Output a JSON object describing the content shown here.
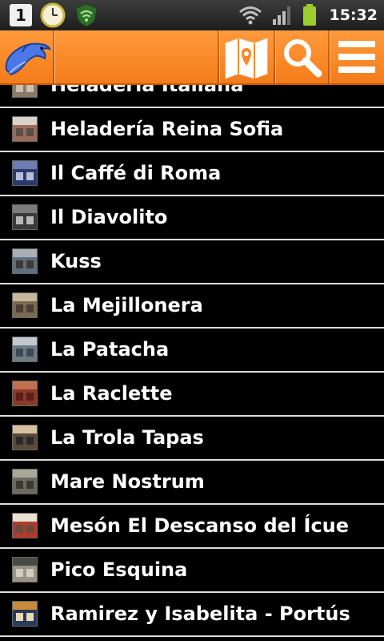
{
  "status_bar": {
    "time": "15:32",
    "notification_badge": "1"
  },
  "app_bar": {
    "logo_icon": "dolphin-logo-icon",
    "map_icon": "map-icon",
    "search_icon": "search-icon",
    "menu_icon": "menu-icon",
    "accent_color": "#f47c1a"
  },
  "list": {
    "items": [
      {
        "label": "Heladería Italiana",
        "thumb": [
          "#8a7a6a",
          "#4d5966",
          "#c9c0b2"
        ]
      },
      {
        "label": "Heladería Reina Sofia",
        "thumb": [
          "#9b6b5a",
          "#d8d2c8",
          "#5a4e46"
        ]
      },
      {
        "label": "Il Caffé di Roma",
        "thumb": [
          "#2c3a6b",
          "#6c7db3",
          "#b5bedb"
        ]
      },
      {
        "label": "Il Diavolito",
        "thumb": [
          "#3a3a3a",
          "#7c7c7c",
          "#b8b8b8"
        ]
      },
      {
        "label": "Kuss",
        "thumb": [
          "#5e6f80",
          "#a8b0b6",
          "#3f3a36"
        ]
      },
      {
        "label": "La Mejillonera",
        "thumb": [
          "#7a6a52",
          "#c8b89a",
          "#4a3e32"
        ]
      },
      {
        "label": "La Patacha",
        "thumb": [
          "#6f7a82",
          "#c3c8cc",
          "#3d4a52"
        ]
      },
      {
        "label": "La Raclette",
        "thumb": [
          "#8b3a2a",
          "#c07050",
          "#5a2018"
        ]
      },
      {
        "label": "La Trola Tapas",
        "thumb": [
          "#5a4a3a",
          "#d8c0a0",
          "#2a2a2a"
        ]
      },
      {
        "label": "Mare Nostrum",
        "thumb": [
          "#6a6a5e",
          "#a8a898",
          "#3a3a30"
        ]
      },
      {
        "label": "Mesón El Descanso del Ícue",
        "thumb": [
          "#b23a2a",
          "#e8e0d0",
          "#6a4a3a"
        ]
      },
      {
        "label": "Pico Esquina",
        "thumb": [
          "#9a9486",
          "#4a4a44",
          "#d0ccc0"
        ]
      },
      {
        "label": "Ramirez y Isabelita - Portús",
        "thumb": [
          "#2a3a5a",
          "#c88a3a",
          "#e8d8b8"
        ]
      }
    ]
  }
}
